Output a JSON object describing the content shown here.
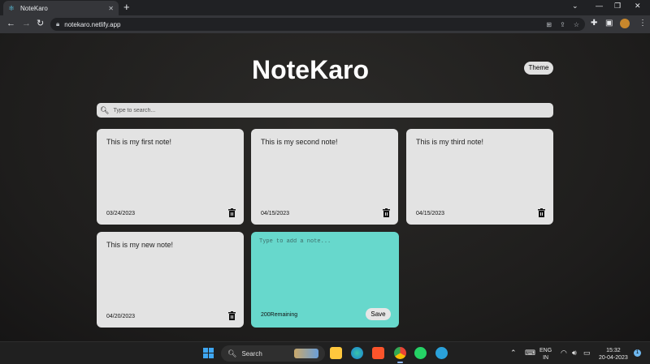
{
  "browser": {
    "tab": {
      "title": "NoteKaro",
      "favicon": "react-atom-icon"
    },
    "url": "notekaro.netlify.app"
  },
  "app": {
    "title": "NoteKaro",
    "theme_label": "Theme",
    "search_placeholder": "Type to search..."
  },
  "notes": [
    {
      "text": "This is my first note!",
      "date": "03/24/2023"
    },
    {
      "text": "This is my second note!",
      "date": "04/15/2023"
    },
    {
      "text": "This is my third note!",
      "date": "04/15/2023"
    },
    {
      "text": "This is my new note!",
      "date": "04/20/2023"
    }
  ],
  "new_note": {
    "placeholder": "Type to add a note...",
    "remaining": "200Remaining",
    "save_label": "Save"
  },
  "taskbar": {
    "search_label": "Search",
    "lang_line1": "ENG",
    "lang_line2": "IN",
    "time": "15:32",
    "date": "20-04-2023",
    "notification_count": "1"
  },
  "colors": {
    "new_note_bg": "#67d8cc",
    "note_bg": "#e3e3e3",
    "page_bg": "#1e1d1c"
  }
}
